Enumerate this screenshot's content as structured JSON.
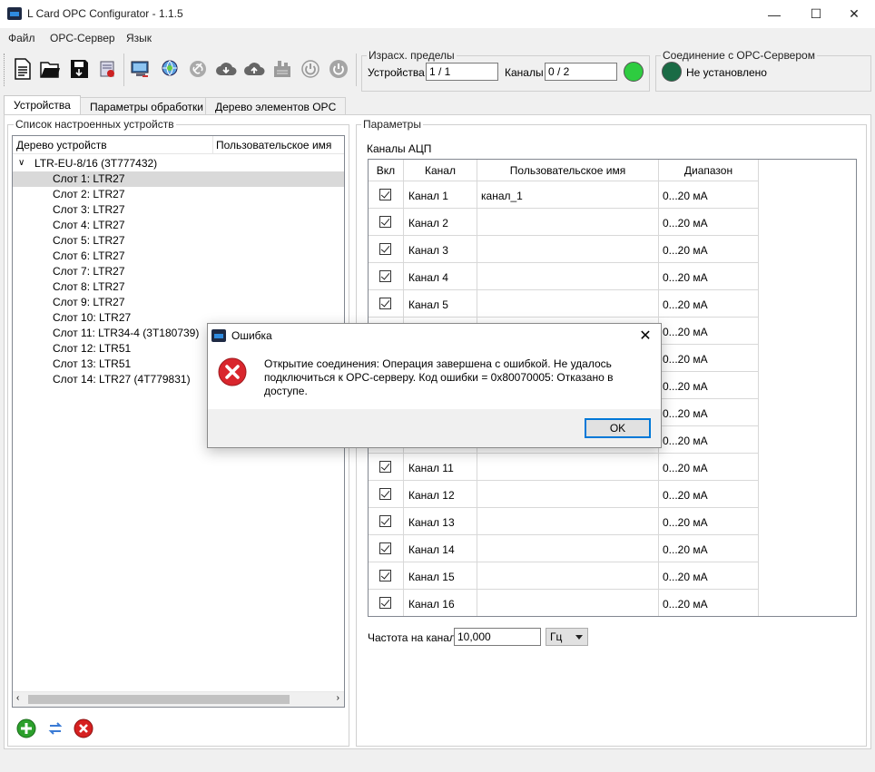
{
  "window": {
    "title": "L Card OPC Configurator - 1.1.5",
    "minimize_glyph": "—",
    "maximize_glyph": "☐",
    "close_glyph": "✕"
  },
  "menu": {
    "items": [
      "Файл",
      "OPC-Сервер",
      "Язык"
    ]
  },
  "limits": {
    "title": "Израсх. пределы",
    "devices_label": "Устройства",
    "devices_value": "1 / 1",
    "channels_label": "Каналы",
    "channels_value": "0 / 2",
    "led_color": "#2ecc40"
  },
  "connection": {
    "title": "Соединение с OPC-Сервером",
    "status": "Не установлено",
    "led_color": "#1a6b45"
  },
  "tabs": [
    "Устройства",
    "Параметры обработки",
    "Дерево элементов OPC"
  ],
  "devices": {
    "group_title": "Список настроенных устройств",
    "col_tree": "Дерево устройств",
    "col_user_name": "Пользовательское имя",
    "root": "LTR-EU-8/16 (3T777432)",
    "slots": [
      "Слот  1: LTR27",
      "Слот  2: LTR27",
      "Слот  3: LTR27",
      "Слот  4: LTR27",
      "Слот  5: LTR27",
      "Слот  6: LTR27",
      "Слот  7: LTR27",
      "Слот  8: LTR27",
      "Слот  9: LTR27",
      "Слот 10: LTR27",
      "Слот 11: LTR34-4 (3T180739)",
      "Слот 12: LTR51",
      "Слот 13: LTR51",
      "Слот 14: LTR27 (4T779831)"
    ]
  },
  "params": {
    "group_title": "Параметры",
    "adc_label": "Каналы АЦП",
    "headers": [
      "Вкл",
      "Канал",
      "Пользовательское имя",
      "Диапазон"
    ],
    "rows": [
      {
        "channel": "Канал 1",
        "user_name": "канал_1",
        "range": "0...20 мА"
      },
      {
        "channel": "Канал 2",
        "user_name": "",
        "range": "0...20 мА"
      },
      {
        "channel": "Канал 3",
        "user_name": "",
        "range": "0...20 мА"
      },
      {
        "channel": "Канал 4",
        "user_name": "",
        "range": "0...20 мА"
      },
      {
        "channel": "Канал 5",
        "user_name": "",
        "range": "0...20 мА"
      },
      {
        "channel": "",
        "user_name": "",
        "range": "0...20 мА"
      },
      {
        "channel": "",
        "user_name": "",
        "range": "0...20 мА"
      },
      {
        "channel": "",
        "user_name": "",
        "range": "0...20 мА"
      },
      {
        "channel": "",
        "user_name": "",
        "range": "0...20 мА"
      },
      {
        "channel": "",
        "user_name": "",
        "range": "0...20 мА"
      },
      {
        "channel": "Канал 11",
        "user_name": "",
        "range": "0...20 мА"
      },
      {
        "channel": "Канал 12",
        "user_name": "",
        "range": "0...20 мА"
      },
      {
        "channel": "Канал 13",
        "user_name": "",
        "range": "0...20 мА"
      },
      {
        "channel": "Канал 14",
        "user_name": "",
        "range": "0...20 мА"
      },
      {
        "channel": "Канал 15",
        "user_name": "",
        "range": "0...20 мА"
      },
      {
        "channel": "Канал 16",
        "user_name": "",
        "range": "0...20 мА"
      }
    ],
    "freq_label": "Частота на канал",
    "freq_value": "10,000",
    "freq_unit": "Гц"
  },
  "dialog": {
    "title": "Ошибка",
    "message": "Открытие соединения: Операция завершена с ошибкой. Не удалось подключиться к OPC-серверу. Код ошибки = 0x80070005: Отказано в доступе.",
    "ok_label": "OK",
    "close_glyph": "✕"
  }
}
